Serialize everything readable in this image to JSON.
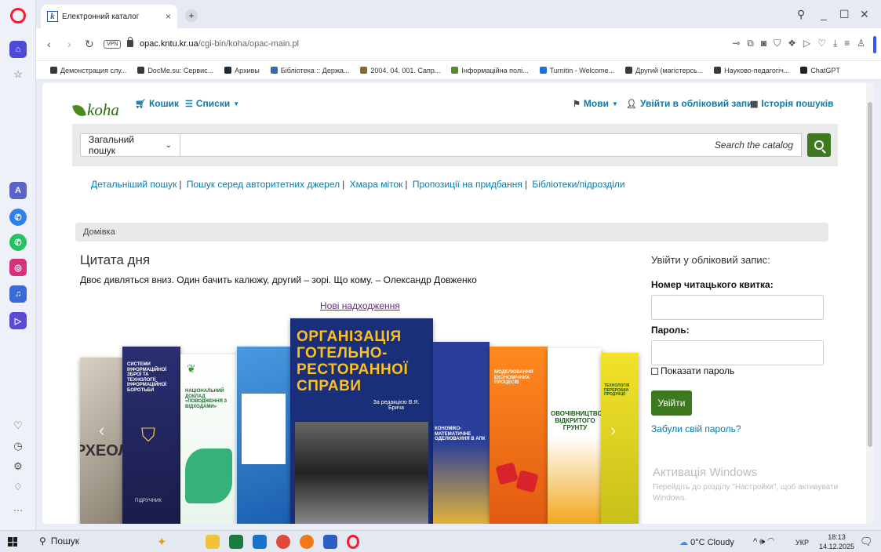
{
  "browser": {
    "tab_title": "Електронний каталог",
    "tab_favicon": "k",
    "new_tab": "+",
    "url_host": "opac.kntu.kr.ua",
    "url_path": "/cgi-bin/koha/opac-main.pl",
    "vpn_label": "VPN",
    "bookmarks": [
      {
        "label": "Демонстрация слу...",
        "icon": "folder-icon",
        "color": "#3a3a3a"
      },
      {
        "label": "DocMe.su: Сервис...",
        "icon": "folder-icon",
        "color": "#3a3a3a"
      },
      {
        "label": "Архивы",
        "icon": "globe-icon",
        "color": "#1f2a3a"
      },
      {
        "label": "Бібліотека :: Держа...",
        "icon": "library-icon",
        "color": "#2f6fb5"
      },
      {
        "label": "2004. 04. 001. Сапр...",
        "icon": "library-icon",
        "color": "#8a6a2a"
      },
      {
        "label": "Інформаційна полі...",
        "icon": "library-icon",
        "color": "#5a8a2a"
      },
      {
        "label": "Turnitin - Welcome...",
        "icon": "turnitin-icon",
        "color": "#1e6fd9"
      },
      {
        "label": "Другий (магістерсь...",
        "icon": "folder-icon",
        "color": "#3a3a3a"
      },
      {
        "label": "Науково-педагогіч...",
        "icon": "folder-icon",
        "color": "#3a3a3a"
      },
      {
        "label": "ChatGPT",
        "icon": "chatgpt-icon",
        "color": "#222222"
      }
    ]
  },
  "koha": {
    "logo": "koha",
    "cart": "Кошик",
    "lists": "Списки",
    "languages": "Мови",
    "login_link": "Увійти в обліковий запис",
    "search_history": "Історія пошуків",
    "search_type": "Загальний пошук",
    "search_placeholder": "Search the catalog",
    "subnav": [
      "Детальніший пошук",
      "Пошук серед авторитетних джерел",
      "Хмара міток",
      "Пропозиції на придбання",
      "Бібліотеки/підрозділи"
    ],
    "breadcrumb": "Домівка",
    "quote_title": "Цитата дня",
    "quote_text": "Двоє дивляться вниз. Один бачить калюжу, другий – зорі. Що кому. – Олександр Довженко",
    "new_arrivals": "Нові надходження",
    "books": [
      {
        "title": "РХЕОЛОГІЯ"
      },
      {
        "title": "СИСТЕМИ ІНФОРМАЦІЙНОЇ ЗБРОЇ ТА ТЕХНОЛОГІЇ ІНФОРМАЦІЙНОЇ БОРОТЬБИ",
        "label": "ПІДРУЧНИК"
      },
      {
        "title": "НАЦІОНАЛЬНИЙ ДОКЛАД «ПОВОДЖЕННЯ З ВІДХОДАМИ»"
      },
      {
        "title": ""
      },
      {
        "title": "ОРГАНІЗАЦІЯ ГОТЕЛЬНО-РЕСТОРАННОЇ СПРАВИ",
        "editor": "За редакцією В.Я. Брича"
      },
      {
        "title": "КОНОМІКО-МАТЕМАТИЧНЕ ОДЕЛЮВАННЯ В АПК"
      },
      {
        "title": "МОДЕЛЮВАННЯ ЕКОНОМІЧНИХ ПРОЦЕСІВ"
      },
      {
        "title": "ОВОЧІВНИЦТВО ВІДКРИТОГО ГРУНТУ"
      },
      {
        "title": "ТЕХНОЛОГІЯ ПЕРЕРОБКИ ПРОДУКЦІЇ"
      }
    ],
    "login": {
      "title": "Увійти у обліковий запис:",
      "card_label": "Номер читацького квитка:",
      "password_label": "Пароль:",
      "show_password": "Показати пароль",
      "submit": "Увійти",
      "forgot": "Забули свій пароль?"
    },
    "windows_activation": {
      "title": "Активація Windows",
      "text": "Перейдіть до розділу \"Настройки\", щоб активувати Windows."
    }
  },
  "taskbar": {
    "search": "Пошук",
    "weather": "0°C Cloudy",
    "language": "УКР",
    "time": "18:13",
    "date": "14.12.2025"
  },
  "colors": {
    "koha_green": "#3d7a1f",
    "link_blue": "#0a7aa6",
    "opera_red": "#ff1b2d"
  }
}
